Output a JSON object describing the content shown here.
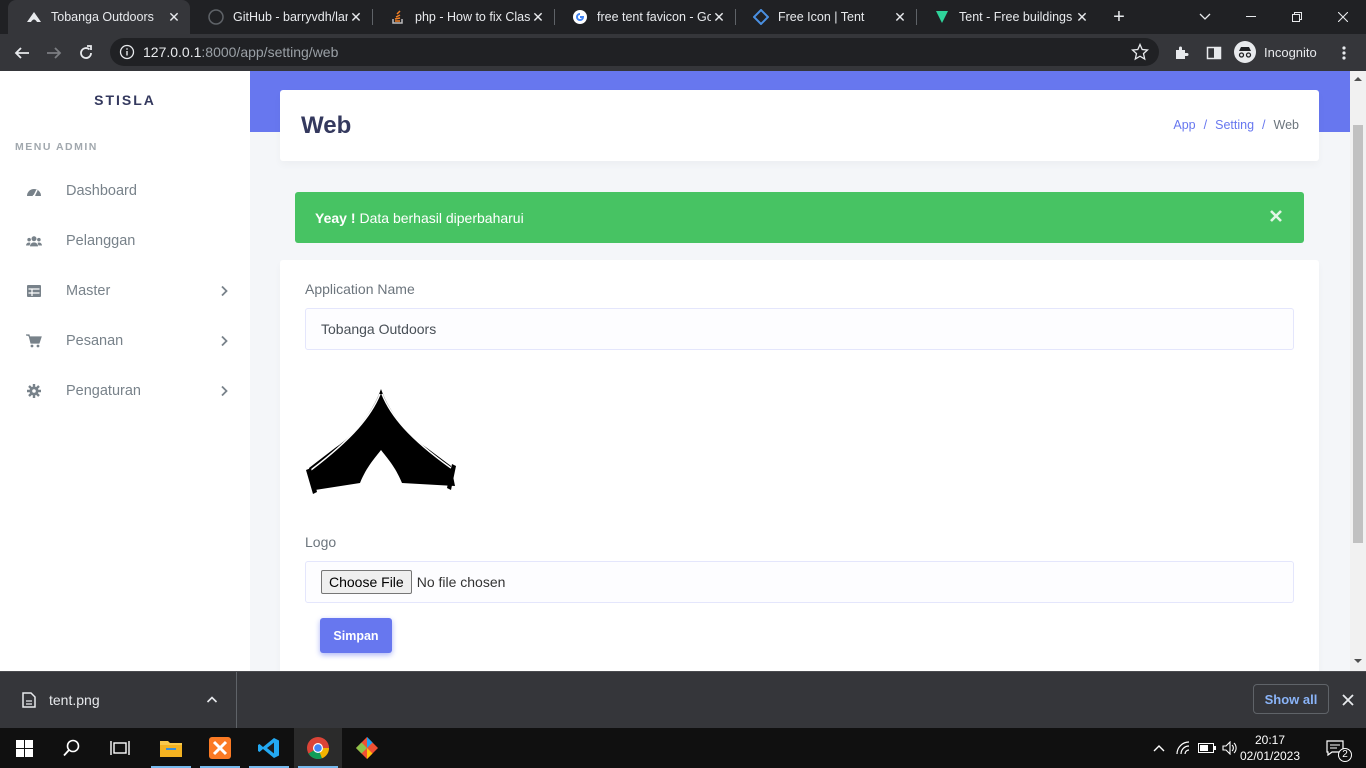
{
  "browser": {
    "tabs": [
      {
        "title": "Tobanga Outdoors",
        "favicon": "tent-icon",
        "active": true
      },
      {
        "title": "GitHub - barryvdh/lara",
        "favicon": "github-icon",
        "active": false
      },
      {
        "title": "php - How to fix Class",
        "favicon": "stackoverflow-icon",
        "active": false
      },
      {
        "title": "free tent favicon - Goo",
        "favicon": "google-icon",
        "active": false
      },
      {
        "title": "Free Icon | Tent",
        "favicon": "freeicon-icon",
        "active": false
      },
      {
        "title": "Tent - Free buildings ic",
        "favicon": "flaticon-icon",
        "active": false
      }
    ],
    "url_host": "127.0.0.1",
    "url_rest": ":8000/app/setting/web",
    "profile_label": "Incognito"
  },
  "sidebar": {
    "brand": "STISLA",
    "menu_header": "MENU ADMIN",
    "items": [
      {
        "label": "Dashboard",
        "icon": "dashboard-icon",
        "has_children": false
      },
      {
        "label": "Pelanggan",
        "icon": "users-icon",
        "has_children": false
      },
      {
        "label": "Master",
        "icon": "table-icon",
        "has_children": true
      },
      {
        "label": "Pesanan",
        "icon": "cart-icon",
        "has_children": true
      },
      {
        "label": "Pengaturan",
        "icon": "gear-icon",
        "has_children": true
      }
    ]
  },
  "header": {
    "title": "Web",
    "breadcrumb": [
      "App",
      "Setting",
      "Web"
    ],
    "breadcrumb_separator": "/"
  },
  "alert": {
    "strong": "Yeay !",
    "message": "Data berhasil diperbaharui",
    "color": "#47c363"
  },
  "form": {
    "app_name_label": "Application Name",
    "app_name_value": "Tobanga Outdoors",
    "logo_label": "Logo",
    "file_button": "Choose File",
    "file_status": "No file chosen",
    "submit_label": "Simpan"
  },
  "downloads": {
    "file_name": "tent.png",
    "show_all": "Show all"
  },
  "taskbar": {
    "time": "20:17",
    "date": "02/01/2023",
    "notification_count": "2"
  },
  "colors": {
    "primary": "#6777ef",
    "success": "#47c363",
    "sidebar_text": "#78828a"
  }
}
